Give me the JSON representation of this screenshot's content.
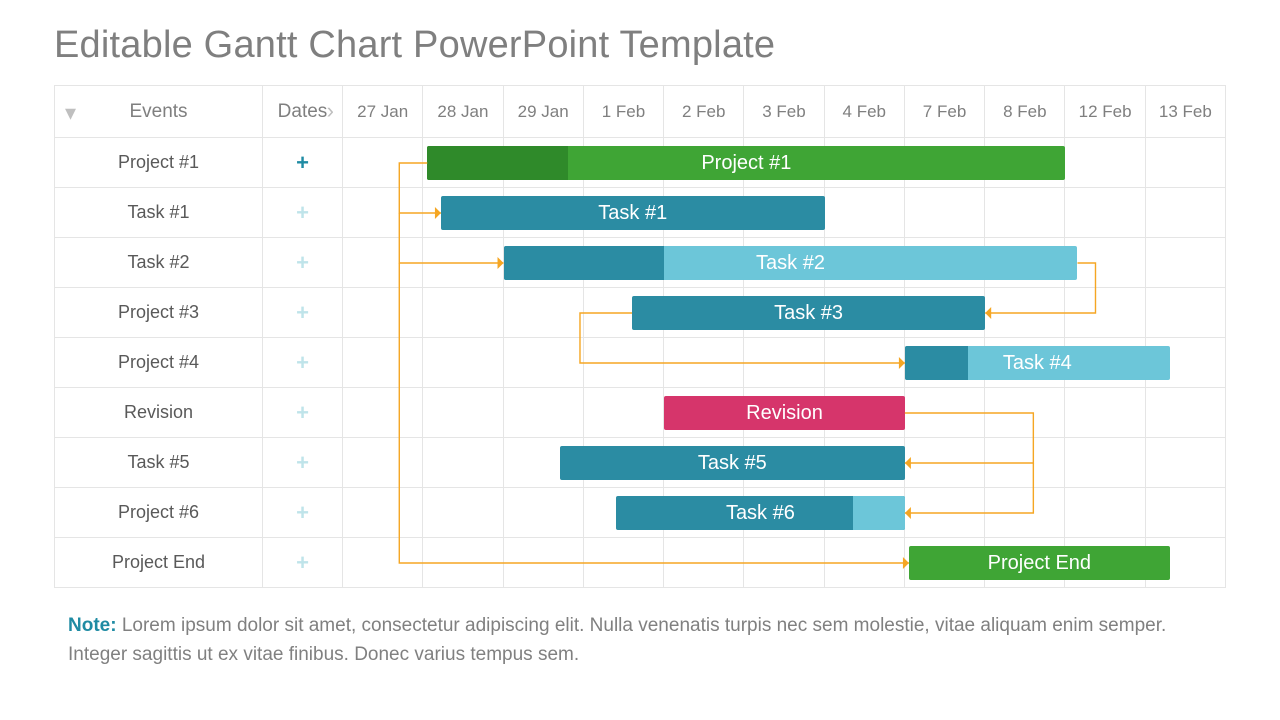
{
  "title": "Editable Gantt Chart PowerPoint Template",
  "columns": {
    "events": "Events",
    "dates": "Dates"
  },
  "date_headers": [
    "27 Jan",
    "28 Jan",
    "29 Jan",
    "1 Feb",
    "2 Feb",
    "3 Feb",
    "4 Feb",
    "7 Feb",
    "8 Feb",
    "12 Feb",
    "13 Feb"
  ],
  "rows": [
    {
      "label": "Project #1",
      "plus": "active"
    },
    {
      "label": "Task #1",
      "plus": "inactive"
    },
    {
      "label": "Task #2",
      "plus": "inactive"
    },
    {
      "label": "Project #3",
      "plus": "inactive"
    },
    {
      "label": "Project #4",
      "plus": "inactive"
    },
    {
      "label": "Revision",
      "plus": "inactive"
    },
    {
      "label": "Task #5",
      "plus": "inactive"
    },
    {
      "label": "Project #6",
      "plus": "inactive"
    },
    {
      "label": "Project End",
      "plus": "inactive"
    }
  ],
  "note_label": "Note:",
  "note_text": "Lorem ipsum dolor sit amet, consectetur adipiscing elit. Nulla venenatis turpis nec sem molestie, vitae aliquam enim semper. Integer sagittis ut ex vitae finibus. Donec varius tempus sem.",
  "colors": {
    "green": "#3fa535",
    "green_dark": "#2f8a2a",
    "teal": "#2b8ca3",
    "teal_light": "#6cc6d9",
    "sky": "#6cc6d9",
    "magenta": "#d6356b",
    "dep": "#f5a623"
  },
  "chart_data": {
    "type": "gantt",
    "x_categories": [
      "27 Jan",
      "28 Jan",
      "29 Jan",
      "1 Feb",
      "2 Feb",
      "3 Feb",
      "4 Feb",
      "7 Feb",
      "8 Feb",
      "12 Feb",
      "13 Feb"
    ],
    "tasks": [
      {
        "row": 0,
        "name": "Project #1",
        "bar_label": "Project #1",
        "start_idx": 1.05,
        "end_idx": 9.0,
        "fill": "green",
        "progress_fill": "green_dark",
        "progress_pct": 22
      },
      {
        "row": 1,
        "name": "Task #1",
        "bar_label": "Task #1",
        "start_idx": 1.22,
        "end_idx": 6.0,
        "fill": "teal",
        "progress_fill": null,
        "progress_pct": 0
      },
      {
        "row": 2,
        "name": "Task #2",
        "bar_label": "Task #2",
        "start_idx": 2.0,
        "end_idx": 9.15,
        "fill": "sky",
        "progress_fill": "teal",
        "progress_pct": 28
      },
      {
        "row": 3,
        "name": "Project #3",
        "bar_label": "Task #3",
        "start_idx": 3.6,
        "end_idx": 8.0,
        "fill": "teal",
        "progress_fill": null,
        "progress_pct": 0
      },
      {
        "row": 4,
        "name": "Project #4",
        "bar_label": "Task #4",
        "start_idx": 7.0,
        "end_idx": 10.3,
        "fill": "sky",
        "progress_fill": "teal",
        "progress_pct": 24
      },
      {
        "row": 5,
        "name": "Revision",
        "bar_label": "Revision",
        "start_idx": 4.0,
        "end_idx": 7.0,
        "fill": "magenta",
        "progress_fill": null,
        "progress_pct": 0
      },
      {
        "row": 6,
        "name": "Task #5",
        "bar_label": "Task #5",
        "start_idx": 2.7,
        "end_idx": 7.0,
        "fill": "teal",
        "progress_fill": null,
        "progress_pct": 0
      },
      {
        "row": 7,
        "name": "Project #6",
        "bar_label": "Task #6",
        "start_idx": 3.4,
        "end_idx": 7.0,
        "fill": "teal",
        "progress_fill": "sky",
        "progress_pct_tail": 18
      },
      {
        "row": 8,
        "name": "Project End",
        "bar_label": "Project End",
        "start_idx": 7.05,
        "end_idx": 10.3,
        "fill": "green",
        "progress_fill": null,
        "progress_pct": 0
      }
    ],
    "dependencies": [
      {
        "from_row": 0,
        "to_row": 1,
        "kind": "start-start"
      },
      {
        "from_row": 0,
        "to_row": 2,
        "kind": "start-start"
      },
      {
        "from_row": 2,
        "to_row": 3,
        "kind": "finish-back"
      },
      {
        "from_row": 3,
        "to_row": 4,
        "kind": "start-down"
      },
      {
        "from_row": 4,
        "to_row": 5,
        "kind": "back-lead"
      },
      {
        "from_row": 5,
        "to_row": 6,
        "kind": "finish-back"
      },
      {
        "from_row": 5,
        "to_row": 7,
        "kind": "finish-back-2"
      },
      {
        "from_row": 0,
        "to_row": 8,
        "kind": "start-down-long"
      }
    ]
  }
}
